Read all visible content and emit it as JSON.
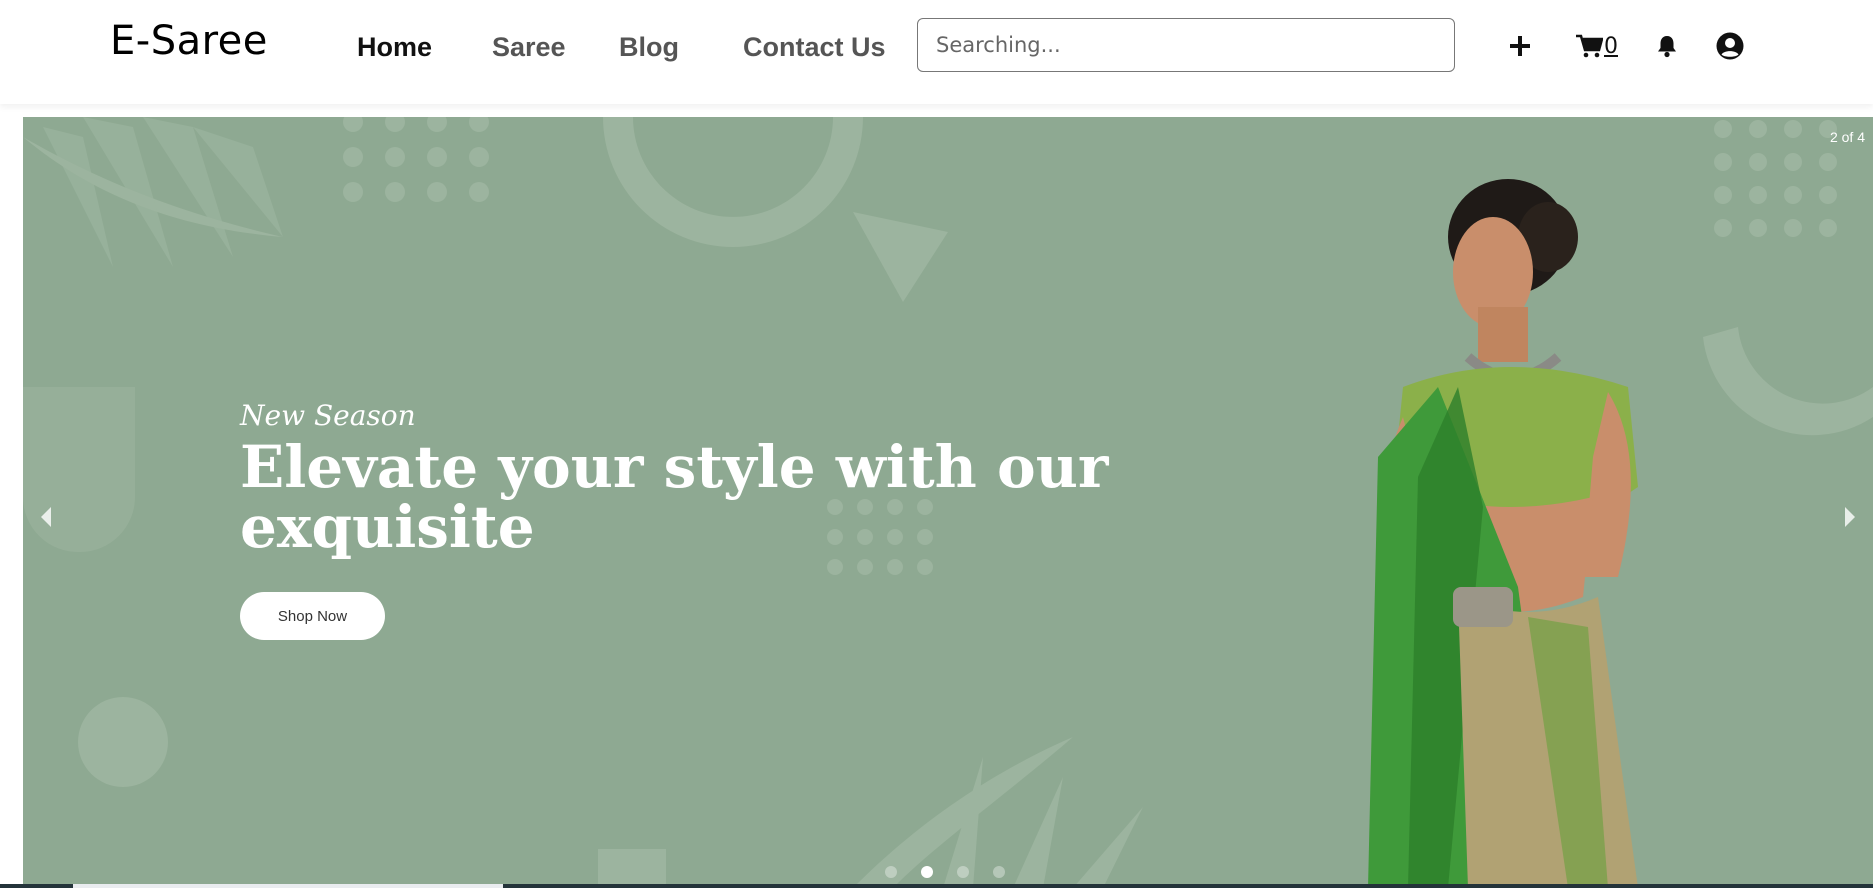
{
  "nav": {
    "brand": "E-Saree",
    "links": [
      {
        "label": "Home",
        "active": true
      },
      {
        "label": "Saree",
        "active": false
      },
      {
        "label": "Blog",
        "active": false
      },
      {
        "label": "Contact Us",
        "active": false
      }
    ],
    "search_placeholder": "Searching...",
    "add_icon": "plus-icon",
    "cart_icon": "cart-icon",
    "cart_count": "0",
    "bell_icon": "bell-icon",
    "user_icon": "user-circle-icon"
  },
  "hero": {
    "slide_counter": "2 of 4",
    "eyebrow": "New Season",
    "headline": "Elevate your style with our exquisite",
    "cta_label": "Shop Now",
    "background_color": "#8ea992",
    "prev_icon": "chevron-left-icon",
    "next_icon": "chevron-right-icon",
    "slides_total": 4,
    "active_slide": 2
  }
}
